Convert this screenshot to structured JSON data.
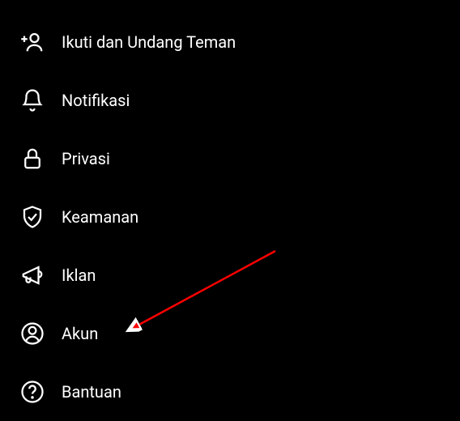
{
  "menu": {
    "items": [
      {
        "label": "Ikuti dan Undang Teman"
      },
      {
        "label": "Notifikasi"
      },
      {
        "label": "Privasi"
      },
      {
        "label": "Keamanan"
      },
      {
        "label": "Iklan"
      },
      {
        "label": "Akun"
      },
      {
        "label": "Bantuan"
      }
    ]
  }
}
